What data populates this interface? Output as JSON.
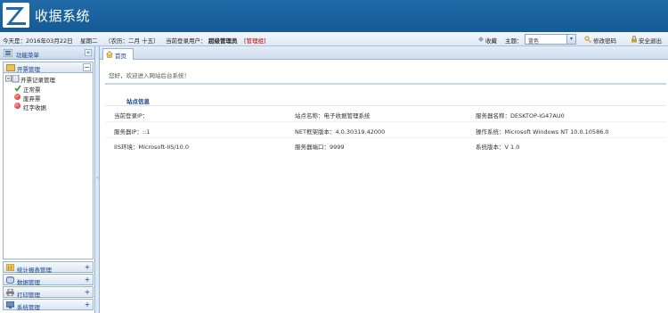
{
  "app": {
    "title": "收据系统"
  },
  "infobar": {
    "date": "今天是：2016年03月22日",
    "weekday": "星期二",
    "lunar": "（农历：二月 十五）",
    "current_user_label": "当前登录用户：",
    "user_name": "超级管理员",
    "user_role": "[管理组]",
    "favorites_label": "收藏",
    "theme_label": "主题：",
    "theme_value": "蓝色",
    "change_password_label": "修改密码",
    "logout_label": "安全退出"
  },
  "sidebar": {
    "title": "功能菜单",
    "panel": {
      "title": "开票管理",
      "group": "开票记录管理",
      "items": [
        {
          "label": "正常票",
          "status": "ok"
        },
        {
          "label": "废弃票",
          "status": "bad"
        },
        {
          "label": "红字收据",
          "status": "bad"
        }
      ]
    },
    "bottom_items": [
      {
        "label": "统计报表管理",
        "icon": "report-icon"
      },
      {
        "label": "数据管理",
        "icon": "data-icon"
      },
      {
        "label": "打印管理",
        "icon": "printer-icon"
      },
      {
        "label": "系统管理",
        "icon": "system-icon"
      }
    ]
  },
  "tabs": [
    {
      "label": "首页"
    }
  ],
  "main": {
    "welcome": "您好，欢迎进入网站后台系统！",
    "section_title": "站点信息",
    "info": [
      [
        "当前登录IP：",
        "站点名称：电子收据管理系统",
        "服务器名称：DESKTOP-IG47AU0"
      ],
      [
        "服务器IP：::1",
        "NET框架版本：4.0.30319.42000",
        "操作系统：Microsoft Windows NT 10.0.10586.0"
      ],
      [
        "IIS环境：Microsoft-IIS/10.0",
        "服务器端口：9999",
        "系统版本：V 1.0"
      ]
    ]
  },
  "colors": {
    "header": "#1f6aa7",
    "accent": "#15428b",
    "alert": "#cc0000"
  }
}
